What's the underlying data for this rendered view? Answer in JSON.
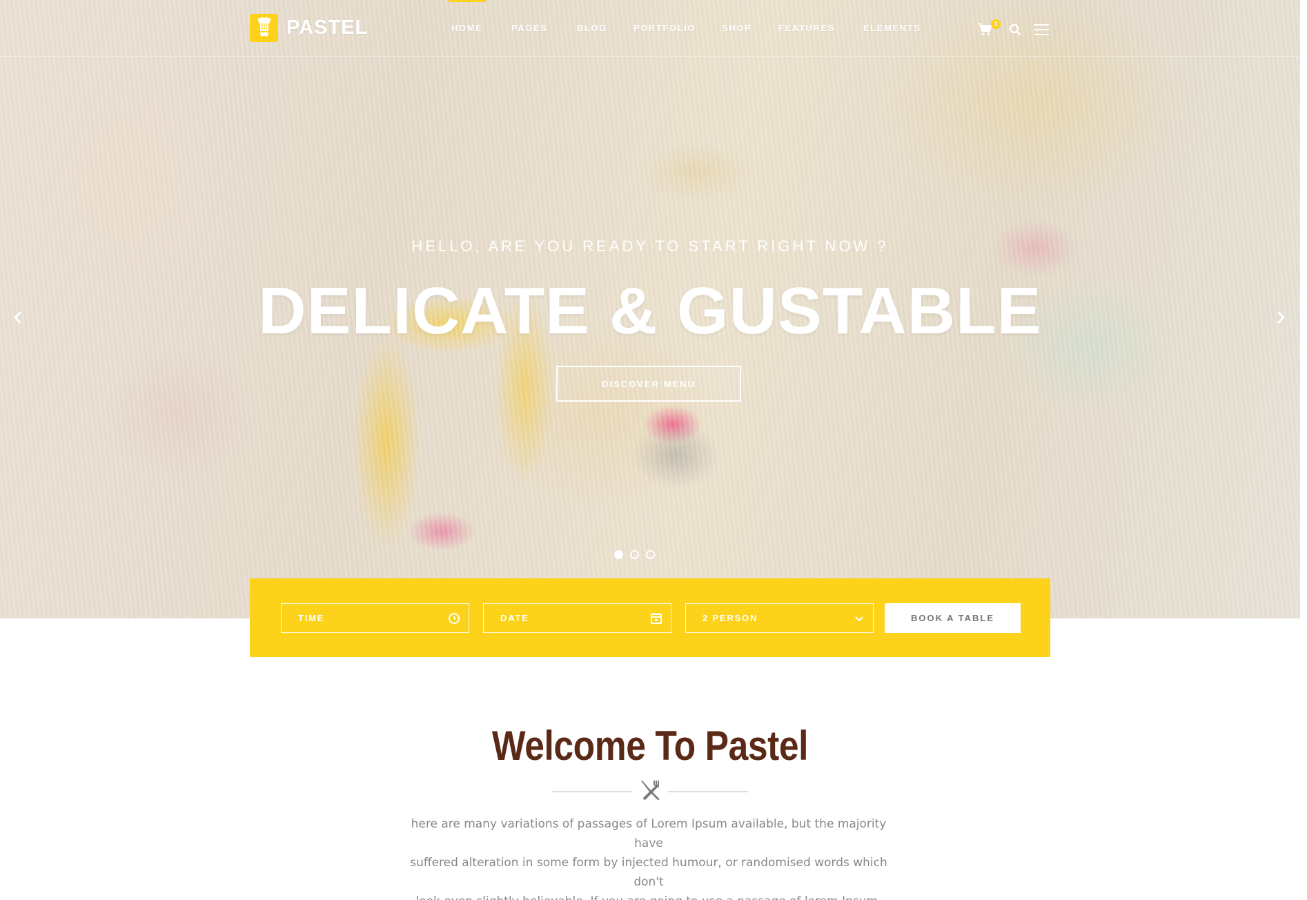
{
  "brand": {
    "name": "PASTEL",
    "accent_color": "#fcd21a",
    "title_color": "#5b2a17"
  },
  "nav": {
    "items": [
      "HOME",
      "PAGES",
      "BLOG",
      "PORTFOLIO",
      "SHOP",
      "FEATURES",
      "ELEMENTS"
    ],
    "active": "HOME"
  },
  "header": {
    "cart_count": "3",
    "icons": [
      "cart-icon",
      "search-icon",
      "menu-icon"
    ]
  },
  "hero": {
    "subtitle": "HELLO, ARE YOU READY TO START RIGHT NOW ?",
    "title": "DELICATE & GUSTABLE",
    "button_label": "DISCOVER MENU",
    "slides_total": 3,
    "slide_active": 1
  },
  "booking": {
    "time_placeholder": "TIME",
    "date_placeholder": "DATE",
    "persons_value": "2 PERSON",
    "button_label": "BOOK A TABLE"
  },
  "welcome": {
    "title": "Welcome To Pastel",
    "text_lines": [
      "here are many variations of passages of Lorem Ipsum available, but the majority have",
      "suffered alteration in some form by injected humour, or randomised words which don't",
      "look even slightly believable. If you are going to use a passage of lorem Ipsum."
    ]
  }
}
